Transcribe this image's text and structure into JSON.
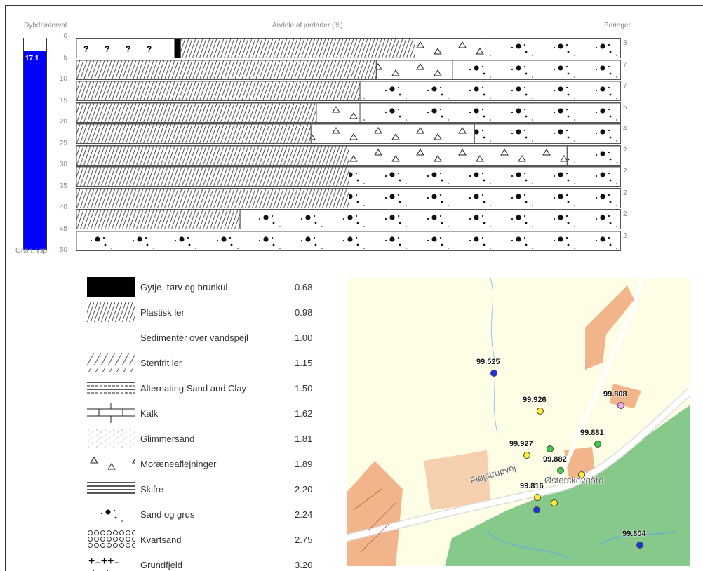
{
  "header": {
    "depth_label": "Dybdeinterval",
    "share_label": "Andele af jordarter (%)",
    "count_label": "Boringer",
    "avg_label": "Gnsn. vsp"
  },
  "water_level": {
    "value_text": "17.1",
    "fill_fraction": 0.94
  },
  "depth_ticks": [
    "0",
    "5",
    "10",
    "15",
    "20",
    "25",
    "30",
    "35",
    "40",
    "45",
    "50"
  ],
  "rows": [
    {
      "count": "8",
      "segments": [
        {
          "type": "unknown",
          "pct": 18
        },
        {
          "type": "gytje",
          "pct": 1.1
        },
        {
          "type": "plastisk",
          "pct": 43
        },
        {
          "type": "morane",
          "pct": 13
        },
        {
          "type": "sand",
          "pct": 24.9
        }
      ]
    },
    {
      "count": "7",
      "segments": [
        {
          "type": "plastisk",
          "pct": 55
        },
        {
          "type": "morane",
          "pct": 14
        },
        {
          "type": "sand",
          "pct": 31
        }
      ]
    },
    {
      "count": "7",
      "segments": [
        {
          "type": "plastisk",
          "pct": 52
        },
        {
          "type": "sand",
          "pct": 48
        }
      ]
    },
    {
      "count": "5",
      "segments": [
        {
          "type": "plastisk",
          "pct": 44
        },
        {
          "type": "morane",
          "pct": 8
        },
        {
          "type": "sand",
          "pct": 48
        }
      ]
    },
    {
      "count": "4",
      "segments": [
        {
          "type": "plastisk",
          "pct": 43
        },
        {
          "type": "morane",
          "pct": 30
        },
        {
          "type": "sand",
          "pct": 27
        }
      ]
    },
    {
      "count": "2",
      "segments": [
        {
          "type": "plastisk",
          "pct": 50
        },
        {
          "type": "morane",
          "pct": 40
        },
        {
          "type": "sand",
          "pct": 10
        }
      ]
    },
    {
      "count": "2",
      "segments": [
        {
          "type": "plastisk",
          "pct": 50
        },
        {
          "type": "sand",
          "pct": 50
        }
      ]
    },
    {
      "count": "2",
      "segments": [
        {
          "type": "plastisk",
          "pct": 50
        },
        {
          "type": "sand",
          "pct": 50
        }
      ]
    },
    {
      "count": "2",
      "segments": [
        {
          "type": "plastisk",
          "pct": 30
        },
        {
          "type": "sand",
          "pct": 70
        }
      ]
    },
    {
      "count": "2",
      "segments": [
        {
          "type": "sand",
          "pct": 100
        }
      ]
    }
  ],
  "legend": [
    {
      "name": "Gytje, tørv og brunkul",
      "value": "0.68",
      "pattern": "gytje"
    },
    {
      "name": "Plastisk ler",
      "value": "0.98",
      "pattern": "plastisk"
    },
    {
      "name": "Sedimenter over vandspejl",
      "value": "1.00",
      "pattern": "blank"
    },
    {
      "name": "Stenfrit ler",
      "value": "1.15",
      "pattern": "stenfrit"
    },
    {
      "name": "Alternating Sand and Clay",
      "value": "1.50",
      "pattern": "alternating"
    },
    {
      "name": "Kalk",
      "value": "1.62",
      "pattern": "kalk"
    },
    {
      "name": "Glimmersand",
      "value": "1.81",
      "pattern": "glimmer"
    },
    {
      "name": "Moræneaflejninger",
      "value": "1.89",
      "pattern": "morane"
    },
    {
      "name": "Skifre",
      "value": "2.20",
      "pattern": "skifre"
    },
    {
      "name": "Sand og grus",
      "value": "2.24",
      "pattern": "sand"
    },
    {
      "name": "Kvartsand",
      "value": "2.75",
      "pattern": "kvarts"
    },
    {
      "name": "Grundfjeld",
      "value": "3.20",
      "pattern": "grundfjeld"
    }
  ],
  "map": {
    "road_label": "Fløjstrupvej",
    "place_label": "Østerskovgård",
    "points": [
      {
        "label": "99.525",
        "color": "#2233dd"
      },
      {
        "label": "99.926",
        "color": "#ffee33"
      },
      {
        "label": "99.808",
        "color": "#eeaaee"
      },
      {
        "label": "99.881",
        "color": "#44cc44"
      },
      {
        "label": "99.927",
        "color": "#ffee33"
      },
      {
        "label": "",
        "color": "#44cc44"
      },
      {
        "label": "99.882",
        "color": "#44cc44"
      },
      {
        "label": "",
        "color": "#ffee33"
      },
      {
        "label": "99.816",
        "color": "#ffee33"
      },
      {
        "label": "",
        "color": "#ffee33"
      },
      {
        "label": "",
        "color": "#2233dd"
      },
      {
        "label": "99.804",
        "color": "#2233dd"
      }
    ]
  },
  "colors": {
    "water_bar": "#0000ff",
    "forest": "#86c98a",
    "buildings": "#f2b48a",
    "map_bg": "#fefee6"
  }
}
